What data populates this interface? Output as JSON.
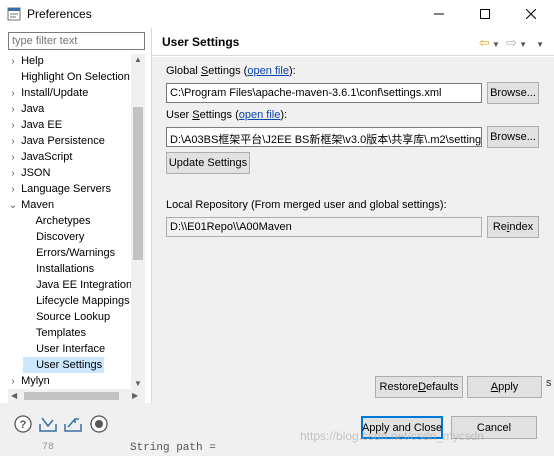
{
  "window": {
    "title": "Preferences",
    "app_icon": "preferences-icon",
    "minimize_icon": "minimize-icon",
    "maximize_icon": "maximize-icon",
    "close_icon": "close-icon"
  },
  "filter": {
    "placeholder": "type filter text"
  },
  "tree": {
    "items": [
      {
        "label": "Help",
        "chevron": "›"
      },
      {
        "label": "Highlight On Selection",
        "chevron": ""
      },
      {
        "label": "Install/Update",
        "chevron": "›"
      },
      {
        "label": "Java",
        "chevron": "›"
      },
      {
        "label": "Java EE",
        "chevron": "›"
      },
      {
        "label": "Java Persistence",
        "chevron": "›"
      },
      {
        "label": "JavaScript",
        "chevron": "›"
      },
      {
        "label": "JSON",
        "chevron": "›"
      },
      {
        "label": "Language Servers",
        "chevron": "›"
      },
      {
        "label": "Maven",
        "chevron": "⌄"
      },
      {
        "label": "Archetypes",
        "chevron": ""
      },
      {
        "label": "Discovery",
        "chevron": ""
      },
      {
        "label": "Errors/Warnings",
        "chevron": ""
      },
      {
        "label": "Installations",
        "chevron": ""
      },
      {
        "label": "Java EE Integration",
        "chevron": ""
      },
      {
        "label": "Lifecycle Mappings",
        "chevron": ""
      },
      {
        "label": "Source Lookup",
        "chevron": ""
      },
      {
        "label": "Templates",
        "chevron": ""
      },
      {
        "label": "User Interface",
        "chevron": ""
      },
      {
        "label": "User Settings",
        "chevron": ""
      },
      {
        "label": "Mylyn",
        "chevron": "›"
      }
    ]
  },
  "page": {
    "title": "User Settings",
    "back_icon": "back-arrow-icon",
    "forward_icon": "forward-arrow-icon",
    "menu_icon": "view-menu-icon",
    "global_label_pre": "Global ",
    "global_label_u": "S",
    "global_label_post": "ettings (",
    "global_link": "open file",
    "global_label_end": "):",
    "global_value": "C:\\Program Files\\apache-maven-3.6.1\\conf\\settings.xml",
    "browse_label": "Browse...",
    "user_label_pre": "User ",
    "user_label_u": "S",
    "user_label_post": "ettings (",
    "user_link": "open file",
    "user_label_end": "):",
    "user_value": "D:\\A03BS框架平台\\J2EE BS新框架\\v3.0版本\\共享库\\.m2\\settings.xml",
    "update_label": "Update Settings",
    "local_label": "Local Repository (From merged user and global settings):",
    "local_value": "D:\\\\E01Repo\\\\A00Maven",
    "reindex_pre": "Re",
    "reindex_u": "i",
    "reindex_post": "ndex",
    "restore_pre": "Restore ",
    "restore_u": "D",
    "restore_post": "efaults",
    "apply_u": "A",
    "apply_post": "pply"
  },
  "bottom": {
    "apply_close": "Apply and Close",
    "cancel": "Cancel",
    "help_icon": "help-icon",
    "import_icon": "import-icon",
    "export_icon": "export-icon",
    "record_icon": "record-icon",
    "background_line_number": "78",
    "background_code": "String path = ",
    "background_char": "s",
    "watermark": "https://blog.csdn.net/csdn_mycsdn"
  }
}
